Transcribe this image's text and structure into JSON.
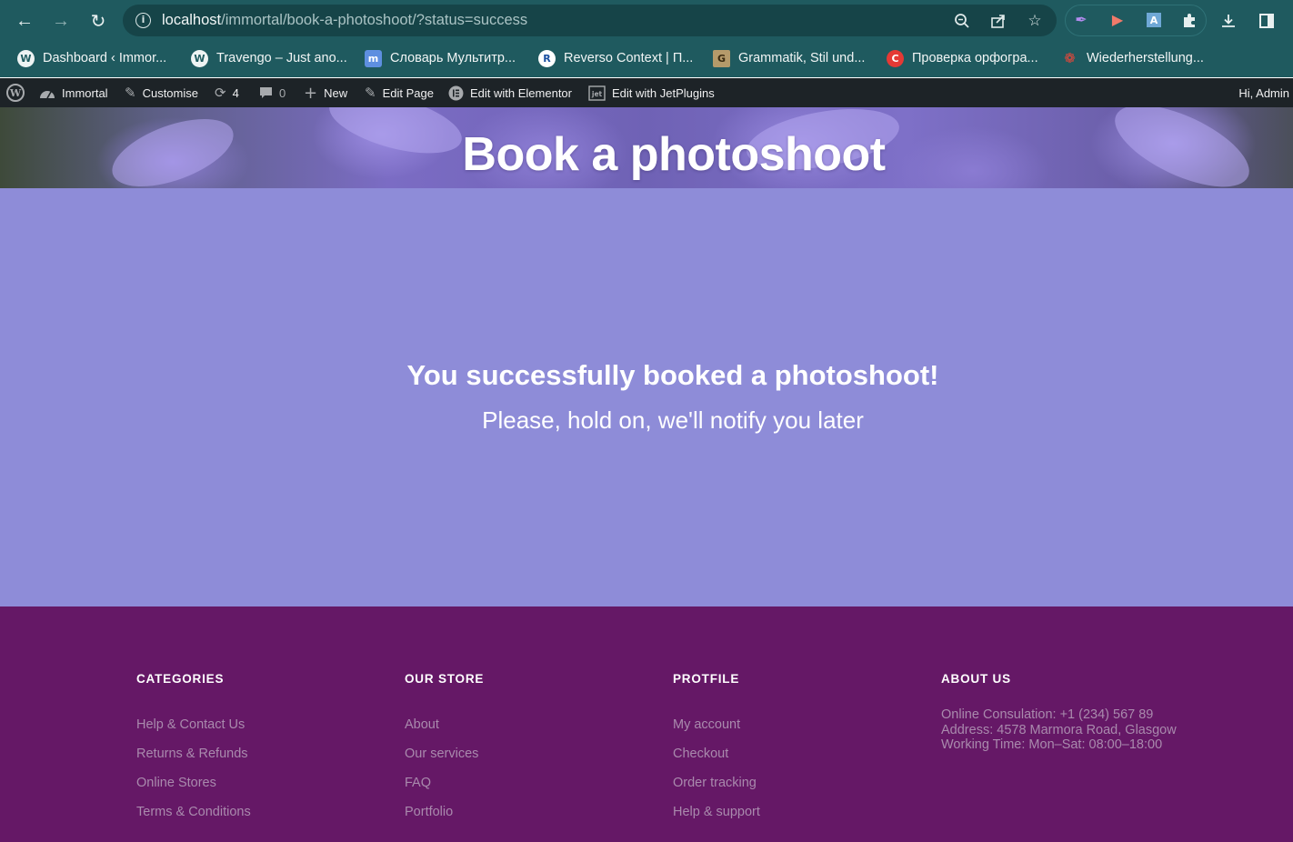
{
  "browser": {
    "url_host": "localhost",
    "url_path": "/immortal/book-a-photoshoot/?status=success",
    "bookmarks": [
      {
        "label": "Dashboard ‹ Immor...",
        "icon": "wordpress-icon"
      },
      {
        "label": "Travengo – Just ano...",
        "icon": "wordpress-icon"
      },
      {
        "label": "Словарь Мультитр...",
        "icon": "multitran-icon"
      },
      {
        "label": "Reverso Context | П...",
        "icon": "reverso-icon"
      },
      {
        "label": "Grammatik, Stil und...",
        "icon": "grammatik-icon"
      },
      {
        "label": "Проверка орфогра...",
        "icon": "spellcheck-icon"
      },
      {
        "label": "Wiederherstellung...",
        "icon": "maple-leaf-icon"
      }
    ]
  },
  "adminbar": {
    "site_name": "Immortal",
    "customise": "Customise",
    "updates_count": "4",
    "comments_count": "0",
    "new": "New",
    "edit_page": "Edit Page",
    "edit_elementor": "Edit with Elementor",
    "edit_jetplugins": "Edit with JetPlugins",
    "greeting": "Hi, Admin"
  },
  "hero": {
    "title": "Book a photoshoot"
  },
  "message": {
    "title": "You successfully booked a photoshoot!",
    "subtitle": "Please, hold on, we'll notify you later"
  },
  "footer": {
    "categories": {
      "heading": "CATEGORIES",
      "links": [
        "Help & Contact Us",
        "Returns & Refunds",
        "Online Stores",
        "Terms & Conditions"
      ]
    },
    "store": {
      "heading": "OUR STORE",
      "links": [
        "About",
        "Our services",
        "FAQ",
        "Portfolio"
      ]
    },
    "profile": {
      "heading": "PROTFILE",
      "links": [
        "My account",
        "Checkout",
        "Order tracking",
        "Help & support"
      ]
    },
    "about": {
      "heading": "ABOUT US",
      "lines": [
        "Online Consulation: +1 (234) 567 89",
        "Address: 4578 Marmora Road, Glasgow",
        "Working Time: Mon–Sat: 08:00–18:00"
      ]
    }
  },
  "colors": {
    "chrome": "#1f5a5f",
    "adminbar": "#1d2327",
    "main_bg": "#8e8cd8",
    "footer_bg": "#651866",
    "footer_link": "#a98aad"
  }
}
